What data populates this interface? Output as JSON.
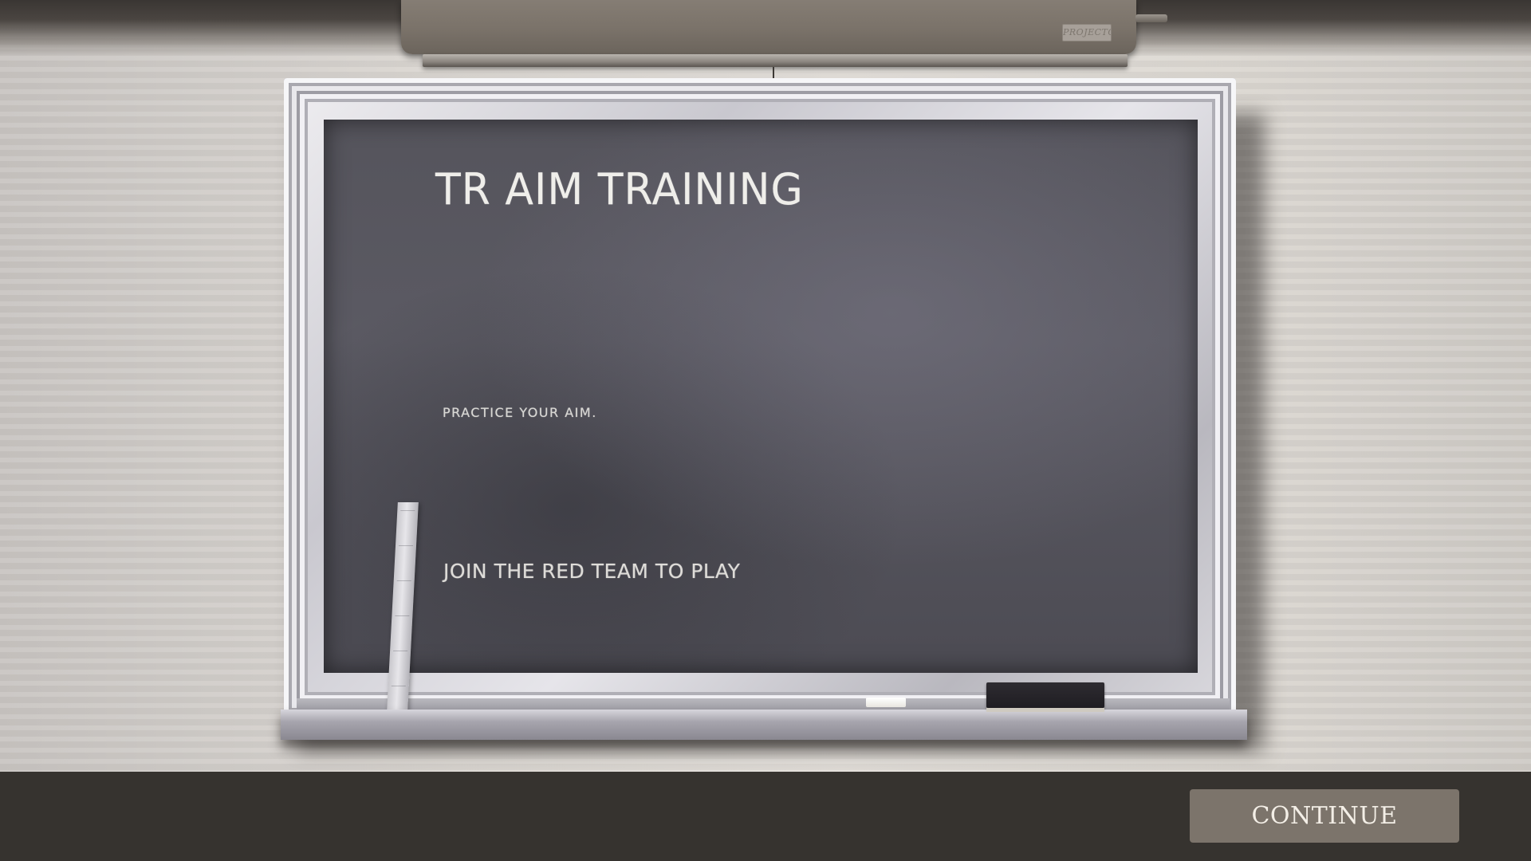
{
  "projector": {
    "label": "PROJECTO"
  },
  "chalkboard": {
    "title": "TR AIM TRAINING",
    "subtitle": "PRACTICE YOUR AIM.",
    "instruction": "JOIN THE RED TEAM TO PLAY"
  },
  "footer": {
    "continue_label": "CONTINUE"
  },
  "colors": {
    "board": "#55545c",
    "chalk_text": "#efeeea",
    "bottom_bar": "#36332f",
    "button": "#7c746b"
  }
}
